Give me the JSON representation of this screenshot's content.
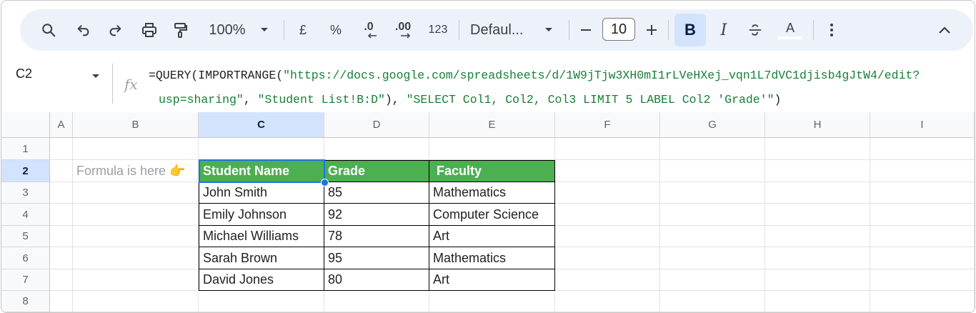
{
  "toolbar": {
    "zoom": "100%",
    "currency": "£",
    "percent": "%",
    "decrease_decimal": ".0",
    "increase_decimal": ".00",
    "number_format": "123",
    "font": "Defaul...",
    "font_size": "10",
    "bold": "B",
    "italic": "I",
    "text_color": "A",
    "icons": [
      "search-icon",
      "undo-icon",
      "redo-icon",
      "print-icon",
      "paint-format-icon",
      "chevron-down-icon",
      "minus-icon",
      "plus-icon",
      "strikethrough-icon",
      "more-vert-icon",
      "chevron-up-icon"
    ]
  },
  "formula_bar": {
    "cell_ref": "C2",
    "fx": "fx",
    "formula": {
      "p1": "=QUERY(IMPORTRANGE(",
      "url_a": "\"https://docs.google.com/spreadsheets/d/1W9jTjw3XH0mI1rLVeHXej_vqn1L7dVC1djisb4gJtW4/edit?",
      "url_b": "usp=sharing\"",
      "p2": ", ",
      "range": "\"Student List!B:D\"",
      "p3": "), ",
      "query": "\"SELECT Col1, Col2, Col3 LIMIT 5 LABEL Col2 'Grade'\"",
      "p4": ")"
    }
  },
  "grid": {
    "columns": [
      "A",
      "B",
      "C",
      "D",
      "E",
      "F",
      "G",
      "H",
      "I"
    ],
    "rows": [
      "1",
      "2",
      "3",
      "4",
      "5",
      "6",
      "7",
      "8"
    ],
    "selected_cell": "C2",
    "note_cell_b2": "Formula is here 👉",
    "table": {
      "header": [
        "Student Name",
        "Grade",
        "Faculty"
      ],
      "rows": [
        [
          "John Smith",
          "85",
          "Mathematics"
        ],
        [
          "Emily Johnson",
          "92",
          "Computer Science"
        ],
        [
          "Michael Williams",
          "78",
          "Art"
        ],
        [
          "Sarah Brown",
          "95",
          "Mathematics"
        ],
        [
          "David Jones",
          "80",
          "Art"
        ]
      ]
    }
  },
  "colors": {
    "toolbar_bg": "#edf2fa",
    "header_green": "#4caf50",
    "selection_blue": "#1a73e8",
    "formula_string_green": "#188038"
  }
}
